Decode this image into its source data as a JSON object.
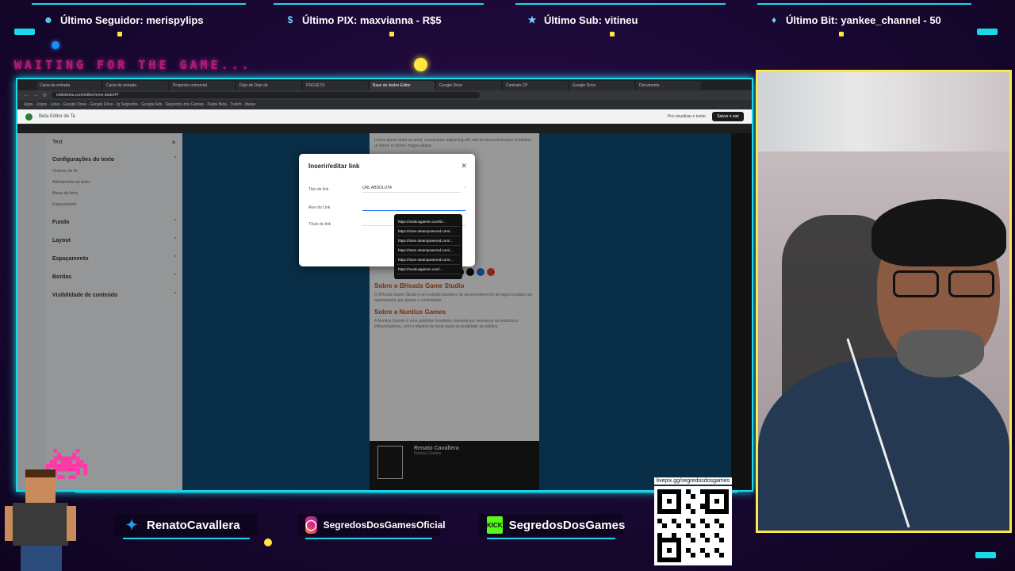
{
  "overlay": {
    "top_alerts": [
      {
        "label": "Último Seguidor: merispylips",
        "icon": "user-icon"
      },
      {
        "label": "Último PIX: maxvianna - R$5",
        "icon": "dollar-icon"
      },
      {
        "label": "Último Sub: vitineu",
        "icon": "star-icon"
      },
      {
        "label": "Último Bit: yankee_channel - 50",
        "icon": "gem-icon"
      }
    ],
    "waiting_text": "WAITING FOR THE GAME...",
    "socials": [
      {
        "name": "twitter",
        "handle": "RenatoCavallera",
        "icon": "twitter-icon"
      },
      {
        "name": "instagram",
        "handle": "SegredosDosGamesOficial",
        "icon": "instagram-icon"
      },
      {
        "name": "kick",
        "handle": "SegredosDosGames",
        "icon": "kick-icon",
        "badge": "KICK"
      }
    ],
    "qr_label": "livepix.gg/segredosdosgames",
    "accent_color": "#1bd8e8",
    "frame_color": "#ffe640"
  },
  "browser": {
    "tabs": [
      "Caixa de entrada",
      "Caixa de entrada",
      "Proposta comercial",
      "Dojo de Dojo de",
      "PROJETO",
      "Base de dados Editor",
      "Google Drive",
      "Contrato CP",
      "Google Drive",
      "Documento"
    ],
    "url": "editorbeta.com/editor/novo-stato/47",
    "bookmarks": "Apps  ·  Jogos  ·  Links  ·  Google Drive  ·  Google Drive  ·  Ig Segredos  ·  Google Ads  ·  Segredos dos Games  ·  Pasta Beta  ·  Twitch  ·  Ideias"
  },
  "editor": {
    "app_name": "Beta Editor de Te",
    "preview_label": "Pré-visualizar e testar",
    "save_label": "Salvar e sair",
    "panel_title": "Text",
    "sections": [
      {
        "title": "Configurações do texto",
        "rows": [
          "Ordenar de IA",
          "Alinhamento do texto",
          "Altura da linha",
          "Espaçamento"
        ]
      },
      {
        "title": "Fundo"
      },
      {
        "title": "Layout"
      },
      {
        "title": "Espaçamento"
      },
      {
        "title": "Bordas"
      },
      {
        "title": "Visibilidade de conteúdo"
      }
    ],
    "doc": {
      "intro": "Lorem ipsum dolor sit amet, consectetur adipiscing elit, sed do eiusmod tempor incididunt ut labore et dolore magna aliqua.",
      "heading1": "Sobre o BHeads Game Studio",
      "body1": "O BHeads Game Studio é um estúdio brasileiro de desenvolvimento de jogos fundado por apaixonados por games e criatividade.",
      "heading2": "Sobre a Nuntius Games",
      "body2": "A Nuntius Games é uma publisher brasileira, fundada por veteranos da indústria e influenciadores, com o objetivo de levar jogos de qualidade ao público.",
      "signature_name": "Renato Cavallera",
      "signature_role": "Nuntius Games"
    }
  },
  "dialog": {
    "title": "Inserir/editar link",
    "type_label": "Tipo de link",
    "type_value": "URL ABSOLUTA",
    "url_label": "Alvo do Link",
    "title_label": "Título do link",
    "suggestions": [
      "https://nuntiusgames.com/br...",
      "https://store.steampowered.com/...",
      "https://store.steampowered.com/...",
      "https://store.steampowered.com/...",
      "https://store.steampowered.com/...",
      "https://nuntiusgames.com/..."
    ]
  }
}
